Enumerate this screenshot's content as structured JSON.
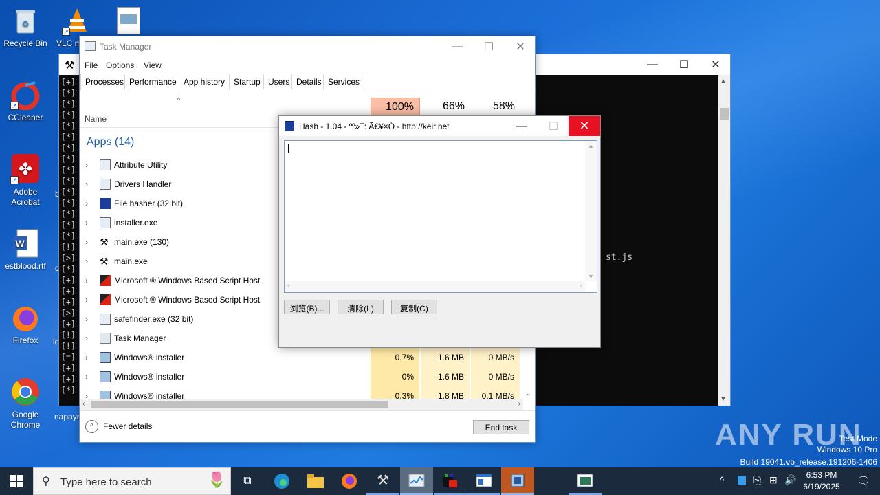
{
  "desktop": {
    "icons": [
      {
        "label": "Recycle Bin"
      },
      {
        "label": "VLC m"
      },
      {
        "label": "CCleaner"
      },
      {
        "label": "Adobe Acrobat"
      },
      {
        "label": "estblood.rtf"
      },
      {
        "label": "Firefox"
      },
      {
        "label": "Google Chrome"
      },
      {
        "label": "b"
      },
      {
        "label": "c"
      },
      {
        "label": "lo"
      },
      {
        "label": "napayn"
      }
    ]
  },
  "console": {
    "lines": "[+]\n[*]\n[*]\n[*]\n[*]\n[*]\n[*]\n[*]\n[*]\n[*]\n[*]\n[*]\n[*]\n[*]\n[*]\n[!]\n[>]\n[*]\n[+]\n[+]\n[+]\n[>]\n[+]\n[!]\n[!]\n[=]\n[+]\n[+]\n[*]",
    "visible_text": "st.js"
  },
  "taskmanager": {
    "title": "Task Manager",
    "menu": [
      "File",
      "Options",
      "View"
    ],
    "tabs": [
      "Processes",
      "Performance",
      "App history",
      "Startup",
      "Users",
      "Details",
      "Services"
    ],
    "columns": {
      "name": "Name",
      "cpu_pct": "100%",
      "mem_pct": "66%",
      "disk_pct": "58%"
    },
    "group_label": "Apps (14)",
    "rows": [
      {
        "name": "Attribute Utility",
        "cpu": "",
        "mem": "",
        "disk": ""
      },
      {
        "name": "Drivers Handler",
        "cpu": "",
        "mem": "",
        "disk": ""
      },
      {
        "name": "File hasher (32 bit)",
        "cpu": "",
        "mem": "",
        "disk": ""
      },
      {
        "name": "installer.exe",
        "cpu": "",
        "mem": "",
        "disk": ""
      },
      {
        "name": "main.exe (130)",
        "cpu": "",
        "mem": "",
        "disk": ""
      },
      {
        "name": "main.exe",
        "cpu": "",
        "mem": "",
        "disk": ""
      },
      {
        "name": "Microsoft ® Windows Based Script Host",
        "cpu": "",
        "mem": "",
        "disk": ""
      },
      {
        "name": "Microsoft ® Windows Based Script Host",
        "cpu": "",
        "mem": "",
        "disk": ""
      },
      {
        "name": "safefinder.exe (32 bit)",
        "cpu": "",
        "mem": "",
        "disk": ""
      },
      {
        "name": "Task Manager",
        "cpu": "",
        "mem": "",
        "disk": ""
      },
      {
        "name": "Windows® installer",
        "cpu": "0.7%",
        "mem": "1.6 MB",
        "disk": "0 MB/s"
      },
      {
        "name": "Windows® installer",
        "cpu": "0%",
        "mem": "1.6 MB",
        "disk": "0 MB/s"
      },
      {
        "name": "Windows® installer",
        "cpu": "0.3%",
        "mem": "1.8 MB",
        "disk": "0.1 MB/s"
      }
    ],
    "fewer_details": "Fewer details",
    "end_task": "End task"
  },
  "hash": {
    "title": "Hash - 1.04 - ºº»¯: Ã€¥×Ó - http://keir.net",
    "buttons": [
      "浏览(B)...",
      "清除(L)",
      "复制(C)"
    ]
  },
  "taskbar": {
    "search_placeholder": "Type here to search",
    "time": "6:53 PM",
    "date": "6/19/2025"
  },
  "watermark": {
    "brand": "ANY RUN",
    "mode": "Test Mode",
    "edition": "Windows 10 Pro",
    "build": "Build 19041.vb_release.191206-1406"
  }
}
